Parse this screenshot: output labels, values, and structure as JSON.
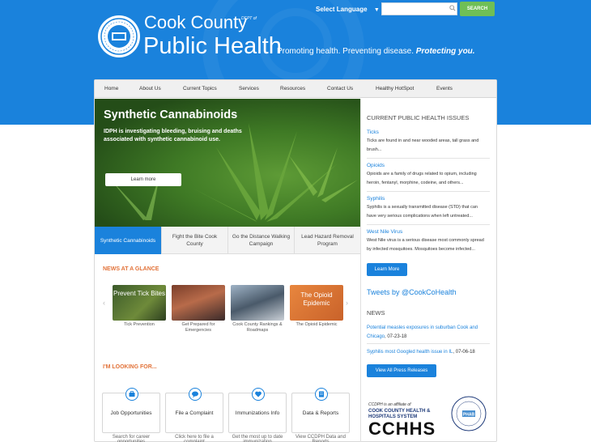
{
  "header": {
    "language_label": "Select Language",
    "search_placeholder": "",
    "search_button": "SEARCH",
    "logo_line1": "Cook County",
    "logo_dept": "DEPT of",
    "logo_line2": "Public Health",
    "tagline": "Promoting health. Preventing disease.",
    "tagline_em": "Protecting you."
  },
  "nav": [
    "Home",
    "About Us",
    "Current Topics",
    "Services",
    "Resources",
    "Contact Us",
    "Healthy HotSpot",
    "Events"
  ],
  "hero": {
    "title": "Synthetic Cannabinoids",
    "text": "IDPH is investigating bleeding, bruising and deaths associated with synthetic cannabinoid use.",
    "button": "Learn more"
  },
  "tabs": [
    "Synthetic Cannabinoids",
    "Fight the Bite Cook County",
    "Go the Distance Walking Campaign",
    "Lead Hazard Removal Program"
  ],
  "news_glance": {
    "title": "NEWS AT A GLANCE",
    "items": [
      {
        "overlay": "Prevent Tick Bites",
        "caption": "Tick Prevention"
      },
      {
        "overlay": "",
        "caption": "Get Prepared for Emergencies"
      },
      {
        "overlay": "",
        "caption": "Cook County Rankings & Roadmaps"
      },
      {
        "overlay": "The Opioid Epidemic",
        "caption": "The Opioid Epidemic"
      }
    ]
  },
  "looking_for": {
    "title": "I'M LOOKING FOR...",
    "boxes": [
      {
        "title": "Job Opportunities",
        "sub": "Search for career opportunities"
      },
      {
        "title": "File a Complaint",
        "sub": "Click here to file a complaint"
      },
      {
        "title": "Immunizations Info",
        "sub": "Get the most up to date immunization"
      },
      {
        "title": "Data & Reports",
        "sub": "View CCDPH Data and Reports"
      }
    ]
  },
  "issues": {
    "title": "CURRENT PUBLIC HEALTH ISSUES",
    "items": [
      {
        "name": "Ticks",
        "text": "Ticks are found in and near wooded areas, tall grass and brush..."
      },
      {
        "name": "Opioids",
        "text": "Opioids are a family of drugs related to opium, including heroin, fentanyl, morphine, codeine, and others..."
      },
      {
        "name": "Syphilis",
        "text": "Syphilis is a sexually transmitted disease (STD) that can have very serious complications when left untreated..."
      },
      {
        "name": "West Nile Virus",
        "text": "West Nile virus is a serious disease most commonly spread by infected mosquitoes. Mosquitoes become infected..."
      }
    ],
    "button": "Learn More"
  },
  "tweets": "Tweets by @CookCoHealth",
  "news": {
    "title": "NEWS",
    "items": [
      {
        "text": "Potential measles exposures in suburban Cook and Chicago",
        "date": ", 07-23-18"
      },
      {
        "text": "Syphilis most Googled health issue in IL",
        "date": ", 07-06-18"
      }
    ],
    "button": "View All Press Releases"
  },
  "affiliate": {
    "note": "CCDPH is an affiliate of",
    "org": "COOK COUNTY HEALTH & HOSPITALS SYSTEM",
    "abbr": "CCHHS",
    "badge": "PHAB"
  },
  "colors": {
    "brand_blue": "#1a82dc",
    "accent_orange": "#e2733a",
    "search_green": "#6fbf56"
  }
}
